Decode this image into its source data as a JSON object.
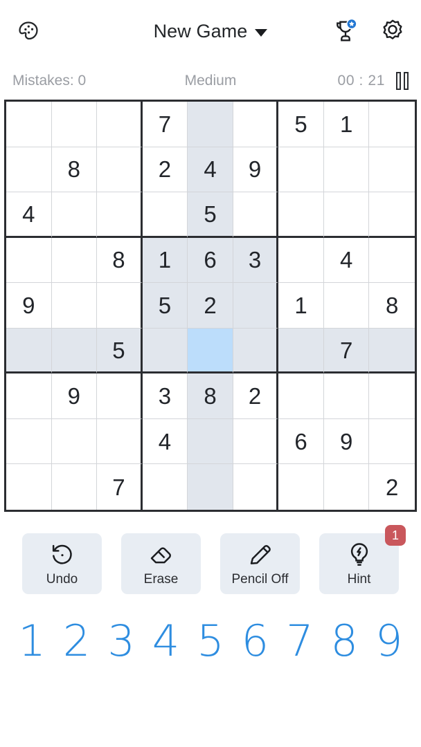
{
  "header": {
    "palette_icon": "palette-icon",
    "title": "New Game",
    "dropdown_icon": "chevron-down-icon",
    "trophy_icon": "trophy-icon",
    "star_badge_icon": "star-icon",
    "settings_icon": "gear-icon"
  },
  "status": {
    "mistakes": "Mistakes: 0",
    "difficulty": "Medium",
    "timer": "00 : 21",
    "pause_icon": "pause-icon"
  },
  "board": {
    "rows": [
      [
        "",
        "",
        "",
        "7",
        "",
        "",
        "5",
        "1",
        ""
      ],
      [
        "",
        "8",
        "",
        "2",
        "4",
        "9",
        "",
        "",
        ""
      ],
      [
        "4",
        "",
        "",
        "",
        "5",
        "",
        "",
        "",
        ""
      ],
      [
        "",
        "",
        "8",
        "1",
        "6",
        "3",
        "",
        "4",
        ""
      ],
      [
        "9",
        "",
        "",
        "5",
        "2",
        "",
        "1",
        "",
        "8"
      ],
      [
        "",
        "",
        "5",
        "",
        "",
        "",
        "",
        "7",
        ""
      ],
      [
        "",
        "9",
        "",
        "3",
        "8",
        "2",
        "",
        "",
        ""
      ],
      [
        "",
        "",
        "",
        "4",
        "",
        "",
        "6",
        "9",
        ""
      ],
      [
        "",
        "",
        "7",
        "",
        "",
        "",
        "",
        "",
        "2"
      ]
    ],
    "selected": {
      "row": 5,
      "col": 4
    },
    "highlight_row": 5,
    "highlight_col": 4,
    "highlight_box": {
      "row_start": 3,
      "col_start": 3
    }
  },
  "actions": [
    {
      "label": "Undo",
      "icon": "undo-icon",
      "badge": ""
    },
    {
      "label": "Erase",
      "icon": "eraser-icon",
      "badge": ""
    },
    {
      "label": "Pencil Off",
      "icon": "pencil-icon",
      "badge": ""
    },
    {
      "label": "Hint",
      "icon": "bulb-icon",
      "badge": "1"
    }
  ],
  "numpad": [
    "1",
    "2",
    "3",
    "4",
    "5",
    "6",
    "7",
    "8",
    "9"
  ],
  "colors": {
    "selected_cell": "#bcddfb",
    "peer_cell": "#e1e6ed",
    "grid_line_major": "#2b2d31",
    "grid_line_minor": "#d3d5d9",
    "numpad_blue": "#2e8de0",
    "badge_red": "#c9575c",
    "button_bg": "#e8edf3",
    "muted_text": "#9a9da3"
  }
}
